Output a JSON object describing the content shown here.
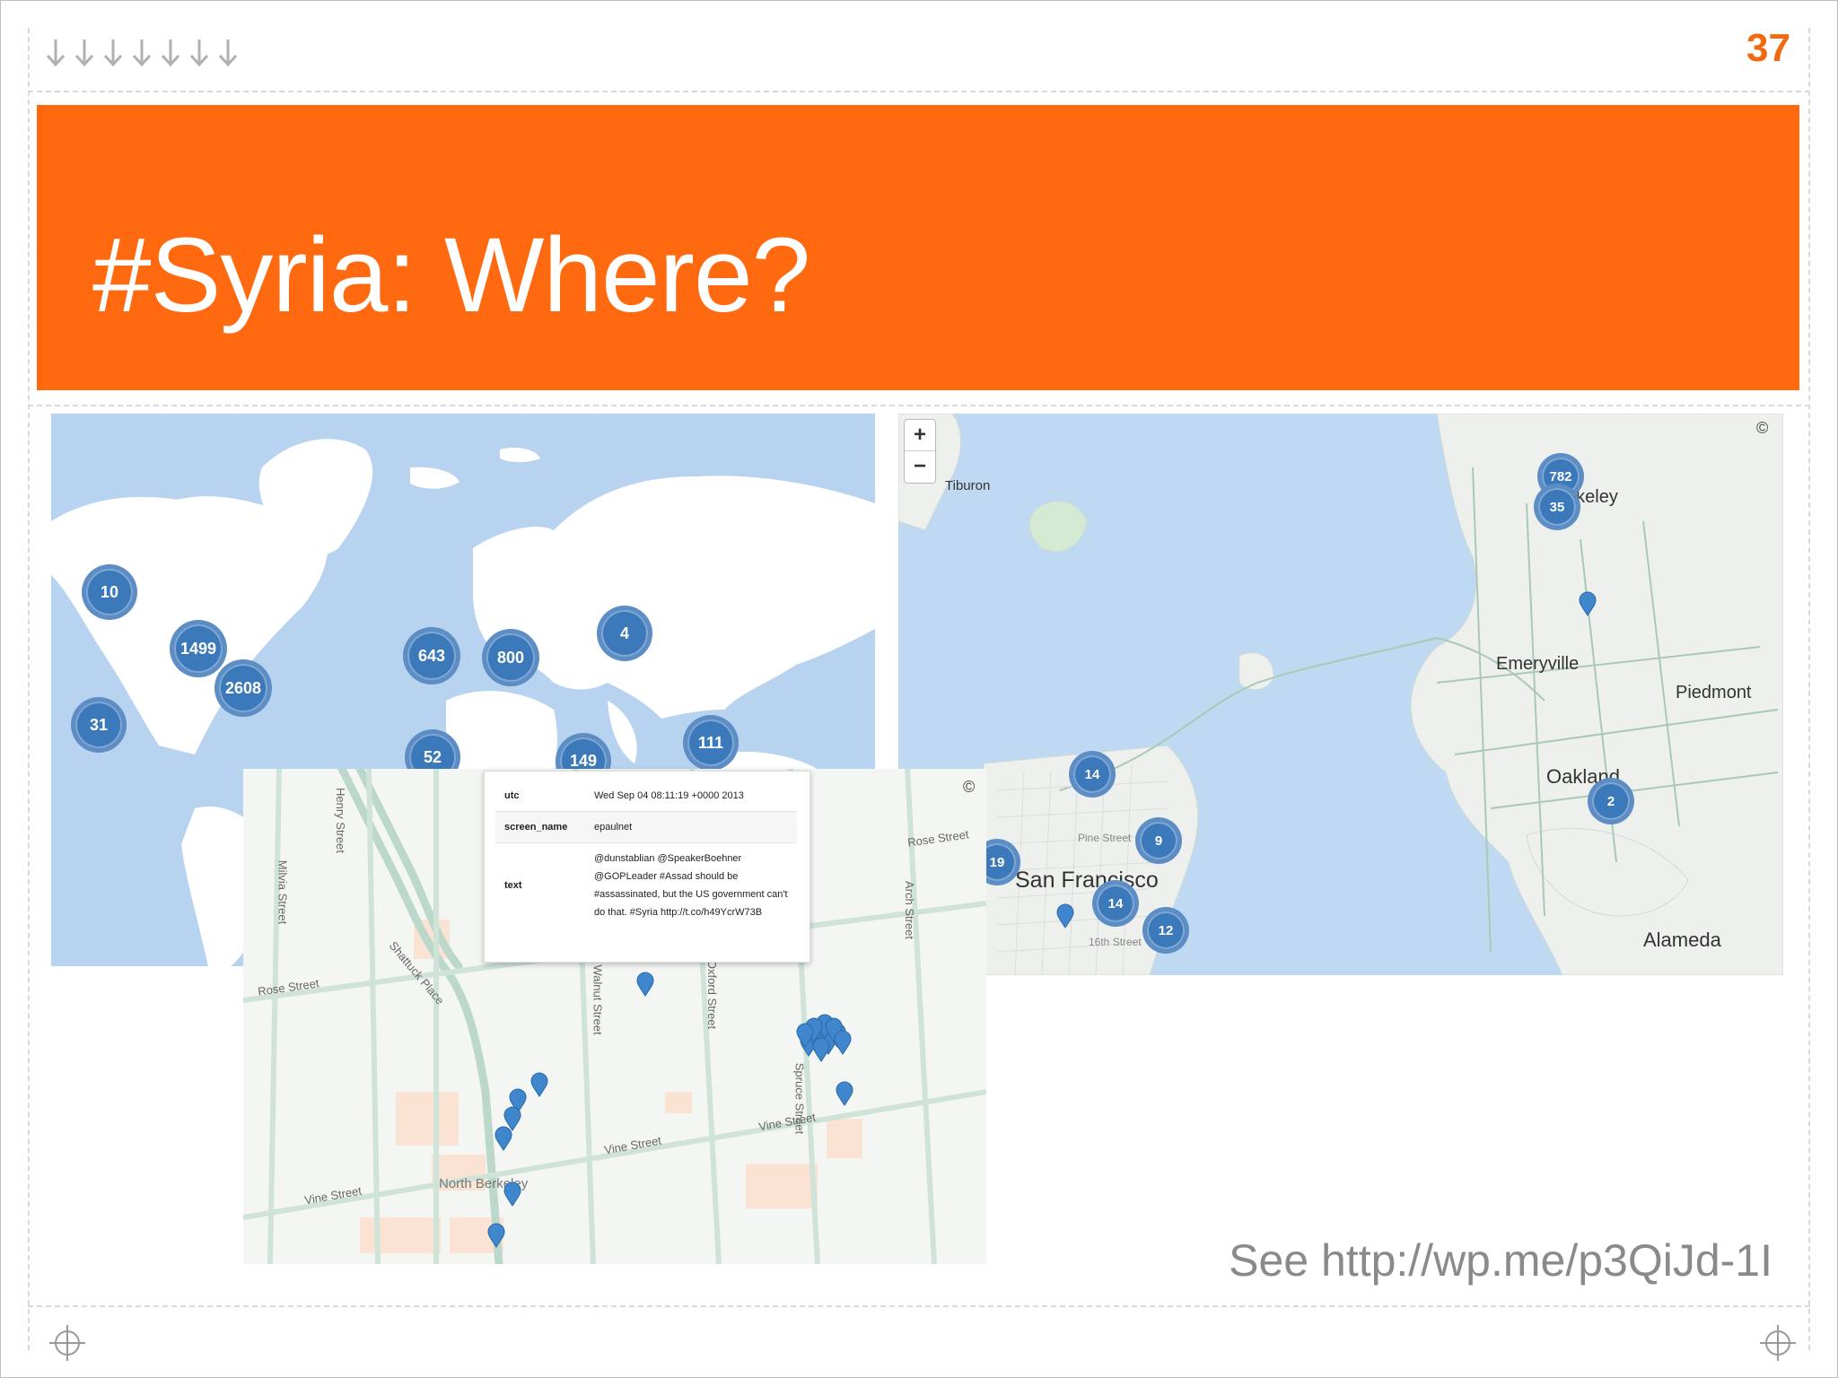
{
  "slide": {
    "number": "37",
    "title": "#Syria: Where?",
    "credit": "See http://wp.me/p3QiJd-1I",
    "accent_color": "#ff6a10"
  },
  "world_map": {
    "clusters": [
      "10",
      "1499",
      "2608",
      "31",
      "643",
      "800",
      "4",
      "52",
      "149",
      "111"
    ]
  },
  "bay_map": {
    "zoom_in_label": "+",
    "zoom_out_label": "−",
    "copyright": "©",
    "places": {
      "tiburon": "Tiburon",
      "berkeley": "Berkeley",
      "emeryville": "Emeryville",
      "piedmont": "Piedmont",
      "oakland": "Oakland",
      "san_francisco": "San Francisco",
      "alameda": "Alameda",
      "pine_street": "Pine Street",
      "sixteenth_street": "16th Street"
    },
    "clusters": [
      "782",
      "35",
      "14",
      "9",
      "19",
      "14",
      "12",
      "2"
    ]
  },
  "street_map": {
    "copyright": "©",
    "streets": {
      "henry_street": "Henry Street",
      "milvia_street": "Milvia Street",
      "rose_street": "Rose Street",
      "shattuck_place": "Shattuck Place",
      "walnut_street": "Walnut Street",
      "oxford_street": "Oxford Street",
      "spruce_street": "Spruce Street",
      "arch_street": "Arch Street",
      "vine_street": "Vine Street",
      "north_berkeley": "North Berkeley"
    },
    "popup": {
      "rows": [
        {
          "key": "utc",
          "value": "Wed Sep 04 08:11:19 +0000 2013"
        },
        {
          "key": "screen_name",
          "value": "epaulnet"
        },
        {
          "key": "text",
          "value": "@dunstablian @SpeakerBoehner @GOPLeader #Assad should be #assassinated, but the US government can't do that. #Syria http://t.co/h49YcrW73B"
        }
      ]
    }
  }
}
